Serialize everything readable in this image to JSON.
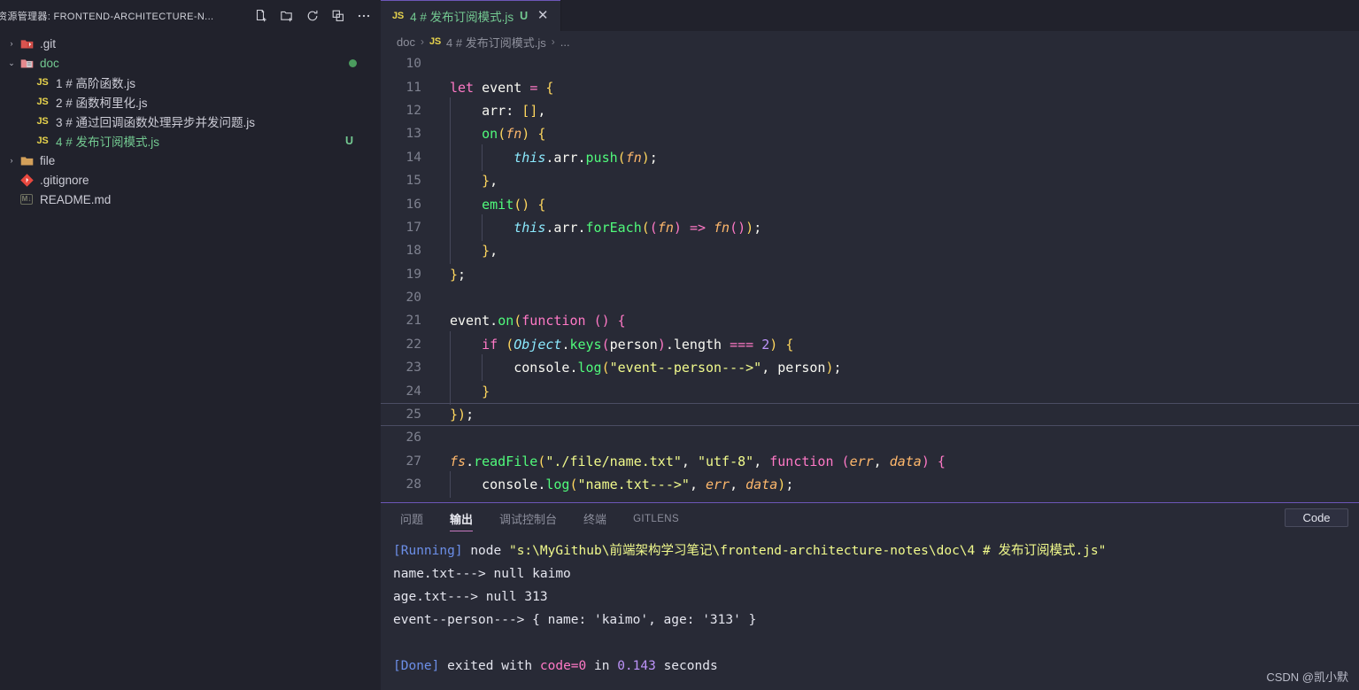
{
  "sidebar": {
    "title": "资源管理器: FRONTEND-ARCHITECTURE-N...",
    "actions": [
      {
        "name": "new-file-icon",
        "tooltip": "新建文件"
      },
      {
        "name": "new-folder-icon",
        "tooltip": "新建文件夹"
      },
      {
        "name": "refresh-icon",
        "tooltip": "刷新资源管理器"
      },
      {
        "name": "collapse-all-icon",
        "tooltip": "在资源管理器中折叠文件夹"
      },
      {
        "name": "more-actions-icon",
        "tooltip": "视图和更多操作..."
      }
    ],
    "tree": [
      {
        "label": ".git",
        "icon": "git-folder-icon",
        "indent": 0,
        "expandable": true,
        "expanded": false,
        "color": "default",
        "badge": "",
        "dot": false
      },
      {
        "label": "doc",
        "icon": "doc-folder-icon",
        "indent": 0,
        "expandable": true,
        "expanded": true,
        "color": "green",
        "badge": "",
        "dot": true
      },
      {
        "label": "1 # 高阶函数.js",
        "icon": "js-icon",
        "indent": 1,
        "expandable": false,
        "expanded": false,
        "color": "default",
        "badge": "",
        "dot": false
      },
      {
        "label": "2 # 函数柯里化.js",
        "icon": "js-icon",
        "indent": 1,
        "expandable": false,
        "expanded": false,
        "color": "default",
        "badge": "",
        "dot": false
      },
      {
        "label": "3 # 通过回调函数处理异步并发问题.js",
        "icon": "js-icon",
        "indent": 1,
        "expandable": false,
        "expanded": false,
        "color": "default",
        "badge": "",
        "dot": false
      },
      {
        "label": "4 # 发布订阅模式.js",
        "icon": "js-icon",
        "indent": 1,
        "expandable": false,
        "expanded": false,
        "color": "green",
        "badge": "U",
        "dot": false
      },
      {
        "label": "file",
        "icon": "folder-icon",
        "indent": 0,
        "expandable": true,
        "expanded": false,
        "color": "default",
        "badge": "",
        "dot": false
      },
      {
        "label": ".gitignore",
        "icon": "gitignore-icon",
        "indent": 0,
        "expandable": false,
        "expanded": false,
        "color": "default",
        "badge": "",
        "dot": false
      },
      {
        "label": "README.md",
        "icon": "markdown-icon",
        "indent": 0,
        "expandable": false,
        "expanded": false,
        "color": "default",
        "badge": "",
        "dot": false
      }
    ]
  },
  "editor": {
    "tab": {
      "icon": "js-icon",
      "label": "4 # 发布订阅模式.js",
      "modifier": "U",
      "close": "✕"
    },
    "breadcrumb": {
      "folder": "doc",
      "sep": "›",
      "file": "4 # 发布订阅模式.js",
      "more": "..."
    },
    "active_line": 25,
    "first_line": 10,
    "lines": [
      {
        "n": 10,
        "text": ""
      },
      {
        "n": 11,
        "text": "let event = {"
      },
      {
        "n": 12,
        "text": "    arr: [],"
      },
      {
        "n": 13,
        "text": "    on(fn) {"
      },
      {
        "n": 14,
        "text": "        this.arr.push(fn);"
      },
      {
        "n": 15,
        "text": "    },"
      },
      {
        "n": 16,
        "text": "    emit() {"
      },
      {
        "n": 17,
        "text": "        this.arr.forEach((fn) => fn());"
      },
      {
        "n": 18,
        "text": "    },"
      },
      {
        "n": 19,
        "text": "};"
      },
      {
        "n": 20,
        "text": ""
      },
      {
        "n": 21,
        "text": "event.on(function () {"
      },
      {
        "n": 22,
        "text": "    if (Object.keys(person).length === 2) {"
      },
      {
        "n": 23,
        "text": "        console.log(\"event--person--->\", person);"
      },
      {
        "n": 24,
        "text": "    }"
      },
      {
        "n": 25,
        "text": "});"
      },
      {
        "n": 26,
        "text": ""
      },
      {
        "n": 27,
        "text": "fs.readFile(\"./file/name.txt\", \"utf-8\", function (err, data) {"
      },
      {
        "n": 28,
        "text": "    console.log(\"name.txt--->\", err, data);"
      }
    ]
  },
  "panel": {
    "tabs": [
      {
        "label": "问题",
        "active": false,
        "latin": false
      },
      {
        "label": "输出",
        "active": true,
        "latin": false
      },
      {
        "label": "调试控制台",
        "active": false,
        "latin": false
      },
      {
        "label": "终端",
        "active": false,
        "latin": false
      },
      {
        "label": "GITLENS",
        "active": false,
        "latin": true
      }
    ],
    "selected_channel": "Code",
    "output": [
      {
        "segments": [
          {
            "t": "[Running] ",
            "c": "t-blue"
          },
          {
            "t": "node ",
            "c": ""
          },
          {
            "t": "\"s:\\MyGithub\\前端架构学习笔记\\frontend-architecture-notes\\doc\\4 # 发布订阅模式.js\"",
            "c": "t-yel"
          }
        ]
      },
      {
        "segments": [
          {
            "t": "name.txt---> null kaimo",
            "c": ""
          }
        ]
      },
      {
        "segments": [
          {
            "t": "age.txt---> null 313",
            "c": ""
          }
        ]
      },
      {
        "segments": [
          {
            "t": "event--person---> { name: 'kaimo', age: '313' }",
            "c": ""
          }
        ]
      },
      {
        "segments": [
          {
            "t": "",
            "c": ""
          }
        ]
      },
      {
        "segments": [
          {
            "t": "[Done] ",
            "c": "t-blue"
          },
          {
            "t": "exited with ",
            "c": ""
          },
          {
            "t": "code=0",
            "c": "t-pink"
          },
          {
            "t": " in ",
            "c": ""
          },
          {
            "t": "0.143",
            "c": "t-pur"
          },
          {
            "t": " seconds",
            "c": ""
          }
        ]
      }
    ]
  },
  "watermark": "CSDN @凯小默",
  "colors": {
    "sidebar_bg": "#21222c",
    "editor_bg": "#282a36",
    "accent_purple": "#6d56b8",
    "green": "#73c991",
    "panel_underline": "#c779c0"
  }
}
